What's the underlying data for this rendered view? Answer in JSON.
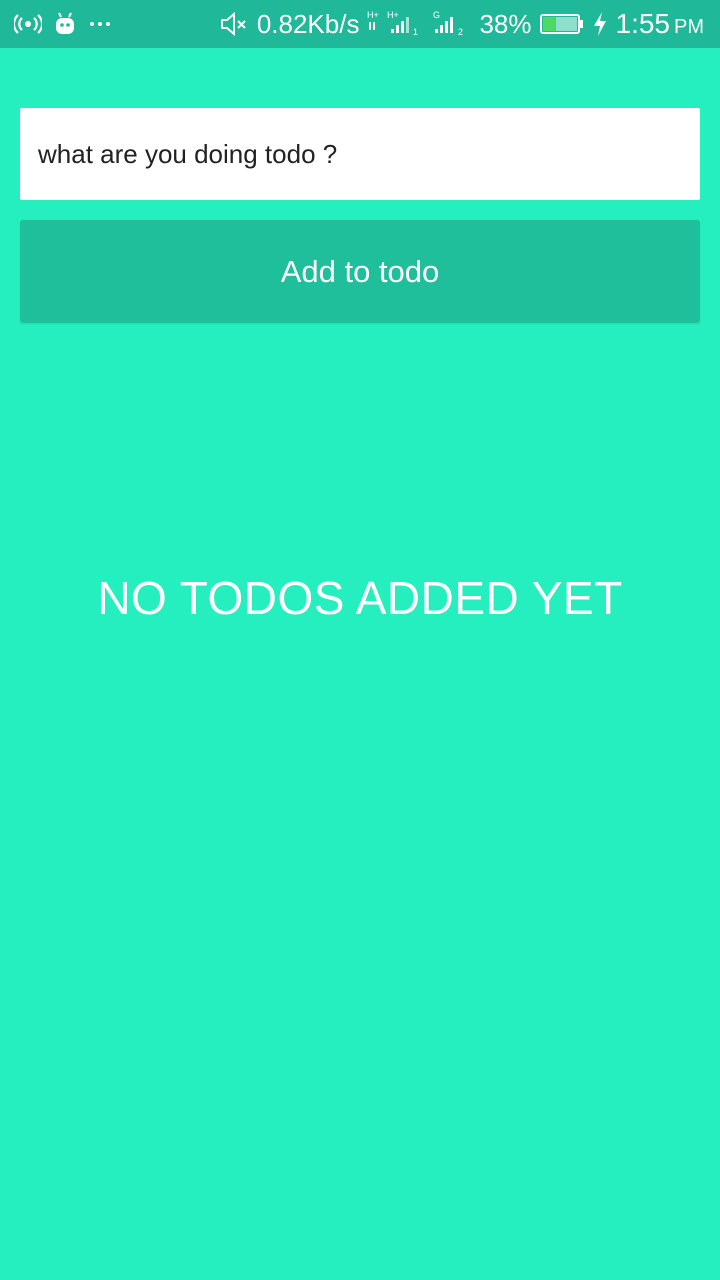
{
  "status_bar": {
    "network_speed": "0.82Kb/s",
    "sim1_label": "1",
    "sim2_label": "2",
    "sim1_type": "H+",
    "sim2_type": "G",
    "battery_percent": "38%",
    "battery_level": 0.38,
    "time": "1:55",
    "ampm": "PM",
    "icons": [
      "hotspot-icon",
      "android-icon",
      "more-dots-icon",
      "mute-icon",
      "signal-icon",
      "battery-icon",
      "charging-icon"
    ]
  },
  "todo": {
    "input_placeholder": "what are you doing todo ?",
    "input_value": "",
    "add_button_label": "Add to todo",
    "empty_message": "NO TODOS ADDED YET"
  },
  "colors": {
    "background": "#25efbe",
    "status_bar": "#1fb899",
    "button": "#1fbf9b",
    "text_light": "#ffffff"
  }
}
